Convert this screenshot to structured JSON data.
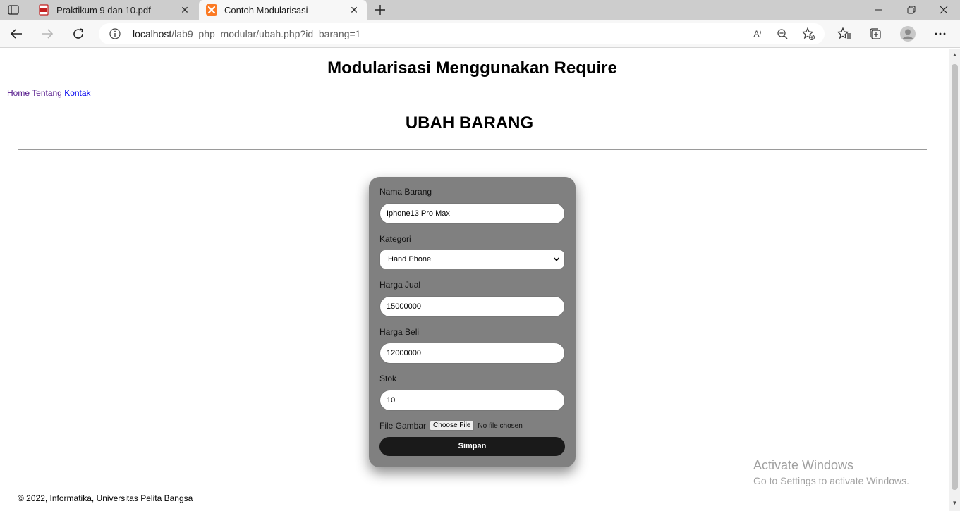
{
  "browser": {
    "tabs": [
      {
        "title": "Praktikum 9 dan 10.pdf"
      },
      {
        "title": "Contoh Modularisasi"
      }
    ],
    "address": {
      "host": "localhost",
      "path": "/lab9_php_modular/ubah.php?id_barang=1"
    },
    "icons": {
      "read_aloud": "A⁾"
    }
  },
  "page": {
    "site_title": "Modularisasi Menggunakan Require",
    "nav": {
      "home": "Home",
      "tentang": "Tentang",
      "kontak": "Kontak"
    },
    "heading": "UBAH BARANG",
    "form": {
      "nama_label": "Nama Barang",
      "nama_value": "Iphone13 Pro Max",
      "kategori_label": "Kategori",
      "kategori_value": "Hand Phone",
      "harga_jual_label": "Harga Jual",
      "harga_jual_value": "15000000",
      "harga_beli_label": "Harga Beli",
      "harga_beli_value": "12000000",
      "stok_label": "Stok",
      "stok_value": "10",
      "file_label": "File Gambar",
      "file_button": "Choose File",
      "file_status": "No file chosen",
      "submit_label": "Simpan"
    },
    "footer": "© 2022, Informatika, Universitas Pelita Bangsa"
  },
  "watermark": {
    "line1": "Activate Windows",
    "line2": "Go to Settings to activate Windows."
  }
}
